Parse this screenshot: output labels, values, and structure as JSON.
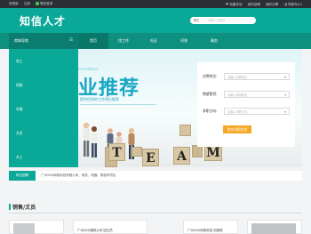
{
  "topbar": {
    "left": [
      "造借家",
      "注册",
      "微信登录"
    ],
    "right": [
      "收藏本站",
      "我的招聘",
      "我的应聘",
      "购物车(0)"
    ]
  },
  "header": {
    "logo": "知信人才",
    "search_select": "职位",
    "search_placeholder": "请输入关键词"
  },
  "nav": {
    "category_head": "商城导航",
    "items": [
      {
        "label": "首页",
        "active": true
      },
      {
        "label": "找工作",
        "active": false
      },
      {
        "label": "社区",
        "active": false
      },
      {
        "label": "问答",
        "active": false
      },
      {
        "label": "服务",
        "active": false
      }
    ]
  },
  "categories": [
    "电工",
    "钳助",
    "车载",
    "文员",
    "木工"
  ],
  "banner": {
    "en": "mendation",
    "title": "业推荐",
    "subtitle": "提供优质的工作岗位推荐",
    "tiles": [
      "T",
      "E",
      "A",
      "M"
    ]
  },
  "form": {
    "fields": [
      {
        "label": "应聘岗位:",
        "placeholder": "请输入应聘岗位"
      },
      {
        "label": "期望薪资:",
        "placeholder": "请输入期望薪资"
      },
      {
        "label": "求职方向:",
        "placeholder": "请输入求职方向"
      }
    ],
    "submit": "提交求职信息"
  },
  "notice": {
    "tag": "职位招聘",
    "text": "广州XXX网络科技有限公司，电机、电器、零部件项目"
  },
  "section": {
    "title": "销售/文员"
  },
  "cards": [
    {
      "text": ""
    },
    {
      "text": "广州XXX建筑公司 招文员"
    },
    {
      "text": "广州XXX网络科技 招销售"
    },
    {
      "text": ""
    }
  ],
  "colors": {
    "brand": "#0aa896",
    "brand_dark": "#0f8f80",
    "accent": "#f5a623"
  }
}
